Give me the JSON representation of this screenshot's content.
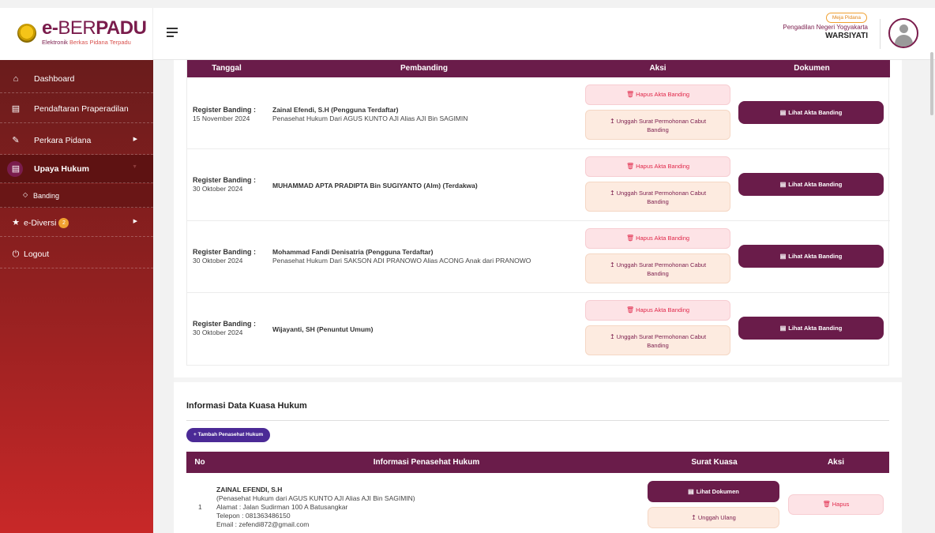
{
  "brand": {
    "name_pre": "e-",
    "name_mid": "BER",
    "name_post": "PADU",
    "subtitle_a": "Elektronik ",
    "subtitle_b": "Berkas Pidana Terpadu"
  },
  "header": {
    "role_badge": "Meja Pidana",
    "court_name": "Pengadilan Negeri Yogyakarta",
    "user_name": "WARSIYATI"
  },
  "sidebar": {
    "items": [
      {
        "label": "Dashboard",
        "icon": "home-icon"
      },
      {
        "label": "Pendaftaran Praperadilan",
        "icon": "document-icon"
      },
      {
        "label": "Perkara Pidana",
        "icon": "edit-icon"
      },
      {
        "label": "Upaya Hukum",
        "icon": "document-icon"
      },
      {
        "label": "Banding",
        "icon": "dot-icon"
      },
      {
        "label": "e-Diversi",
        "icon": "star-icon",
        "badge": "2"
      },
      {
        "label": "Logout",
        "icon": "power-icon"
      }
    ]
  },
  "banding_table": {
    "headers": [
      "Tanggal",
      "Pembanding",
      "Aksi",
      "Dokumen"
    ],
    "rows": [
      {
        "reg_label": "Register Banding :",
        "date": "15 November 2024",
        "name": "Zainal Efendi, S.H (Pengguna Terdaftar)",
        "desc": "Penasehat Hukum Dari AGUS KUNTO AJI Alias AJI Bin SAGIMIN"
      },
      {
        "reg_label": "Register Banding :",
        "date": "30 Oktober 2024",
        "name": "MUHAMMAD APTA PRADIPTA Bin SUGIYANTO (Alm) (Terdakwa)",
        "desc": ""
      },
      {
        "reg_label": "Register Banding :",
        "date": "30 Oktober 2024",
        "name": "Mohammad Fandi Denisatria (Pengguna Terdaftar)",
        "desc": "Penasehat Hukum Dari SAKSON ADI PRANOWO Alias ACONG Anak dari PRANOWO"
      },
      {
        "reg_label": "Register Banding :",
        "date": "30 Oktober 2024",
        "name": "Wijayanti, SH (Penuntut Umum)",
        "desc": ""
      }
    ],
    "btn_hapus_akta": "Hapus Akta Banding",
    "btn_unggah_cabut_1": "Unggah Surat Permohonan Cabut",
    "btn_unggah_cabut_2": "Banding",
    "btn_lihat_akta": "Lihat Akta Banding"
  },
  "kuasa": {
    "title": "Informasi Data Kuasa Hukum",
    "btn_tambah": "+ Tambah Penasehat Hukum",
    "headers": [
      "No",
      "Informasi Penasehat Hukum",
      "Surat Kuasa",
      "Aksi"
    ],
    "row": {
      "no": "1",
      "name": "ZAINAL EFENDI, S.H",
      "line1": "(Penasehat Hukum dari AGUS KUNTO AJI Alias AJI Bin SAGIMIN)",
      "line2": "Alamat : Jalan Sudirman 100 A Batusangkar",
      "line3": "Telepon : 081363486150",
      "line4": "Email : zefendi872@gmail.com"
    },
    "btn_lihat_dokumen": "Lihat Dokumen",
    "btn_unggah_ulang": "Unggah Ulang",
    "btn_hapus": "Hapus"
  }
}
